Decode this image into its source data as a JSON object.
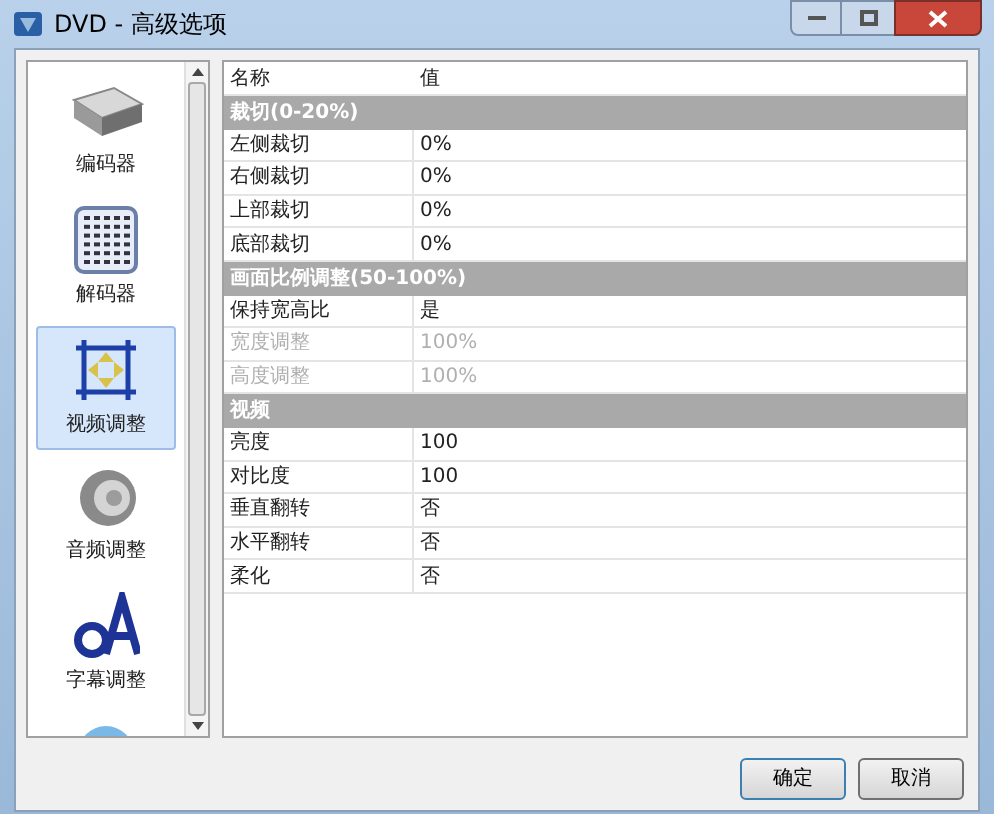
{
  "window": {
    "title": "DVD - 高级选项"
  },
  "sidebar": {
    "items": [
      {
        "kind": "encoder",
        "label": "编码器",
        "selected": false
      },
      {
        "kind": "decoder",
        "label": "解码器",
        "selected": false
      },
      {
        "kind": "video",
        "label": "视频调整",
        "selected": true
      },
      {
        "kind": "audio",
        "label": "音频调整",
        "selected": false
      },
      {
        "kind": "subtitle",
        "label": "字幕调整",
        "selected": false
      },
      {
        "kind": "disc",
        "selected": false
      }
    ]
  },
  "grid": {
    "columns": [
      "名称",
      "值"
    ],
    "rows": [
      {
        "kind": "section",
        "label": "裁切(0-20%)"
      },
      {
        "kind": "property",
        "name": "左侧裁切",
        "value": "0%",
        "disabled": false
      },
      {
        "kind": "property",
        "name": "右侧裁切",
        "value": "0%",
        "disabled": false
      },
      {
        "kind": "property",
        "name": "上部裁切",
        "value": "0%",
        "disabled": false
      },
      {
        "kind": "property",
        "name": "底部裁切",
        "value": "0%",
        "disabled": false
      },
      {
        "kind": "section",
        "label": "画面比例调整(50-100%)"
      },
      {
        "kind": "property",
        "name": "保持宽高比",
        "value": "是",
        "disabled": false
      },
      {
        "kind": "property",
        "name": "宽度调整",
        "value": "100%",
        "disabled": true
      },
      {
        "kind": "property",
        "name": "高度调整",
        "value": "100%",
        "disabled": true
      },
      {
        "kind": "section",
        "label": "视频"
      },
      {
        "kind": "property",
        "name": "亮度",
        "value": "100",
        "disabled": false
      },
      {
        "kind": "property",
        "name": "对比度",
        "value": "100",
        "disabled": false
      },
      {
        "kind": "property",
        "name": "垂直翻转",
        "value": "否",
        "disabled": false
      },
      {
        "kind": "property",
        "name": "水平翻转",
        "value": "否",
        "disabled": false
      },
      {
        "kind": "property",
        "name": "柔化",
        "value": "否",
        "disabled": false
      }
    ]
  },
  "buttons": [
    "确定",
    "取消"
  ]
}
